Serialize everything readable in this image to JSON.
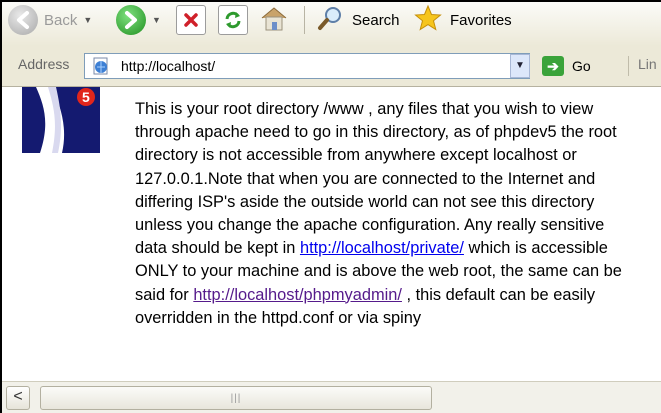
{
  "toolbar": {
    "back_label": "Back",
    "search_label": "Search",
    "favorites_label": "Favorites"
  },
  "address_bar": {
    "label": "Address",
    "url": "http://localhost/",
    "go_label": "Go",
    "links_label": "Lin"
  },
  "content": {
    "text_1": "This is your root directory /www , any files that you wish to view through apache need to go in this directory, as of phpdev5 the root directory is not accessible from anywhere except localhost or 127.0.0.1.Note that when you are connected to the Internet and differing ISP's aside the outside world can not see this directory unless you change the apache configuration. Any really sensitive data should be kept in ",
    "link_private": "http://localhost/private/",
    "text_2": " which is accessible ONLY to your machine and is above the web root, the same can be said for ",
    "link_phpmyadmin": "http://localhost/phpmyadmin/",
    "text_3": " , this default can be easily overridden in the httpd.conf or via spiny"
  },
  "colors": {
    "link": "#0000ee",
    "visited_link": "#551a8b",
    "chrome": "#ece9d8"
  },
  "icons": [
    "back-icon",
    "forward-icon",
    "stop-icon",
    "refresh-icon",
    "home-icon",
    "search-icon",
    "favorites-star-icon",
    "page-icon",
    "go-arrow-icon",
    "scroll-left-icon",
    "phpdev5-logo"
  ]
}
